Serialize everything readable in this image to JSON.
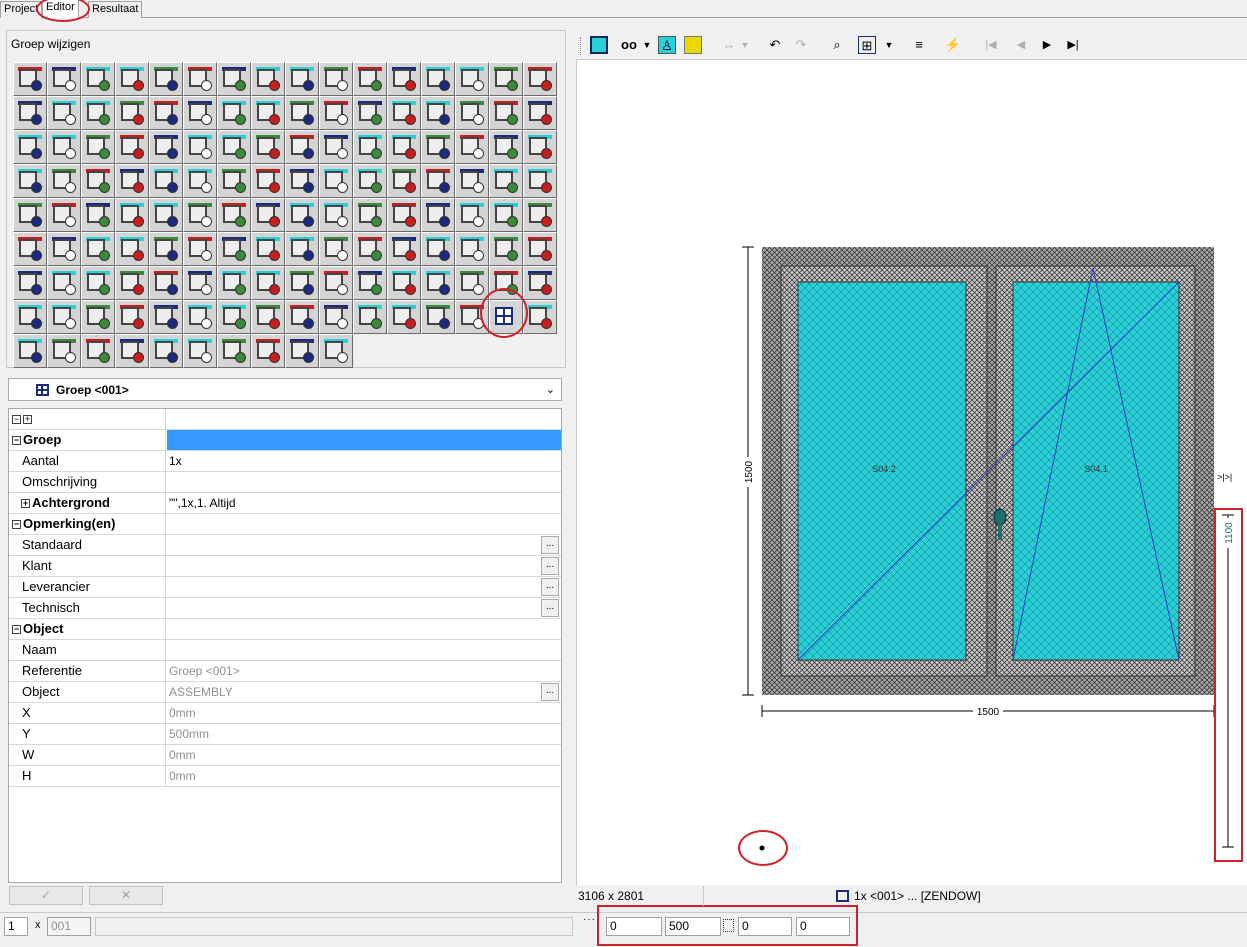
{
  "tabs": [
    "Project",
    "Editor",
    "Resultaat"
  ],
  "editor_panel": {
    "title": "Groep wijzigen",
    "tool_count": 138
  },
  "group_dropdown": {
    "value": "Groep <001>"
  },
  "properties": [
    {
      "name": "Groep",
      "value": "",
      "section": true,
      "selected": true
    },
    {
      "name": "Aantal",
      "value": "1x"
    },
    {
      "name": "Omschrijving",
      "value": ""
    },
    {
      "name": "Achtergrond",
      "value": "\"\",1x,1. Altijd",
      "expandable": true,
      "bold": true
    },
    {
      "name": "Opmerking(en)",
      "value": "",
      "section": true
    },
    {
      "name": "Standaard",
      "value": "",
      "button": true
    },
    {
      "name": "Klant",
      "value": "",
      "button": true
    },
    {
      "name": "Leverancier",
      "value": "",
      "button": true
    },
    {
      "name": "Technisch",
      "value": "",
      "button": true
    },
    {
      "name": "Object",
      "value": "",
      "section": true
    },
    {
      "name": "Naam",
      "value": ""
    },
    {
      "name": "Referentie",
      "value": "Groep <001>",
      "grey": true
    },
    {
      "name": "Object",
      "value": "ASSEMBLY",
      "grey": true,
      "button": true
    },
    {
      "name": "X",
      "value": "0mm",
      "grey": true
    },
    {
      "name": "Y",
      "value": "500mm",
      "grey": true
    },
    {
      "name": "W",
      "value": "0mm",
      "grey": true
    },
    {
      "name": "H",
      "value": "0mm",
      "grey": true
    }
  ],
  "ellipsis": "...",
  "confirm_buttons": [
    "✓",
    "✕"
  ],
  "status": {
    "count": "1",
    "x_sign": "x",
    "code": "001"
  },
  "coords": [
    "0",
    "500",
    "0",
    "0"
  ],
  "viewer": {
    "canvas_size": "3106 x 2801",
    "selection": "1x <001> ... [ZENDOW]",
    "width_label": "1500",
    "height_label": "1500",
    "side_dimension": "1100",
    "arrows": ">|>|"
  },
  "window_labels": [
    "S04.2",
    "S04.1"
  ],
  "colors": {
    "glass": "#29d0d8",
    "frame": "#a9a9a9",
    "highlight": "#3399ff",
    "annotation": "#d0202a"
  }
}
